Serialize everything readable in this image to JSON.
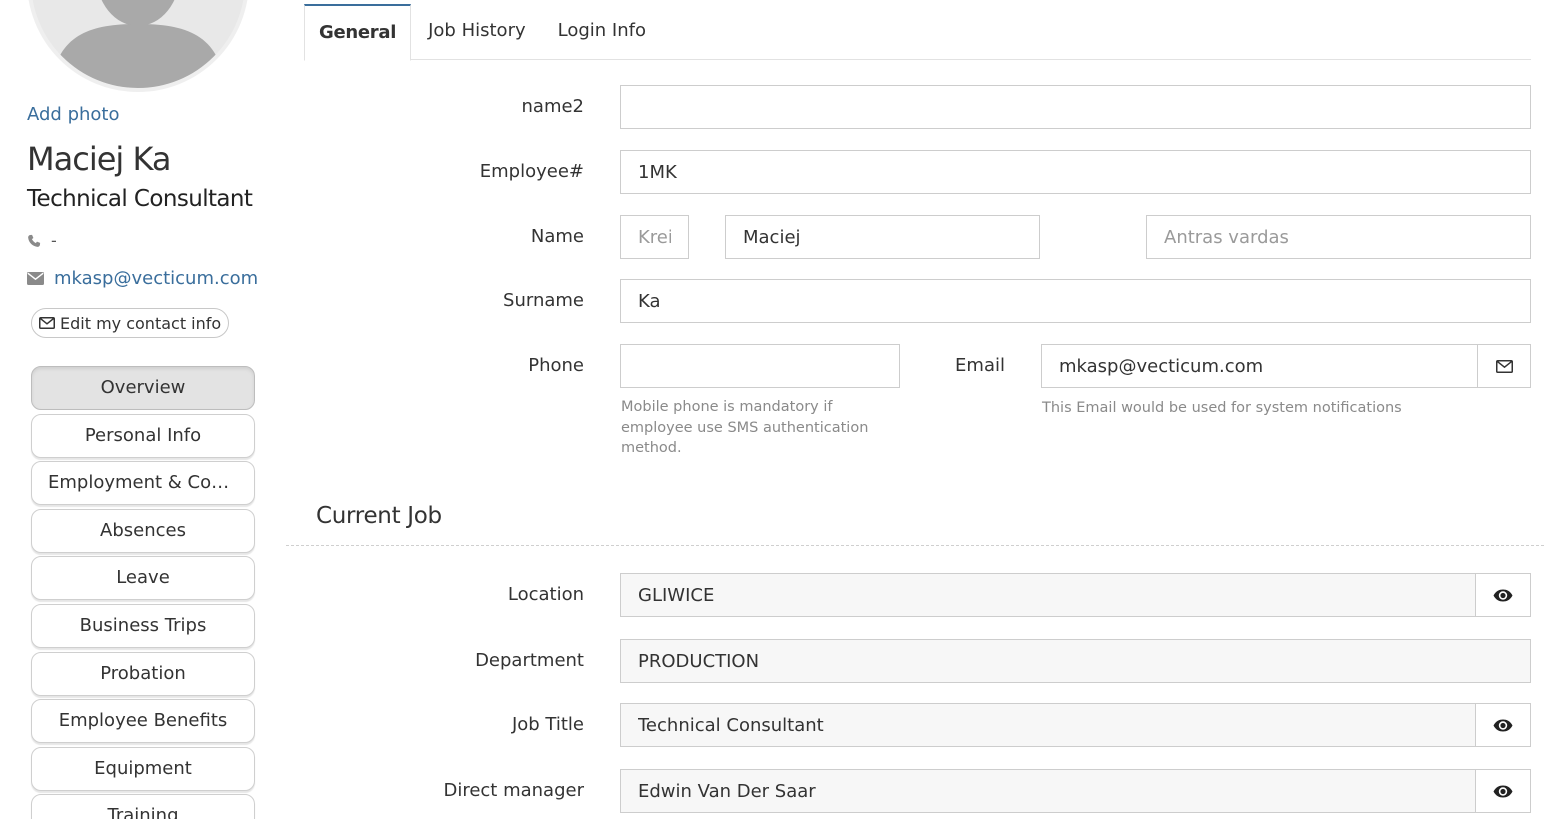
{
  "profile": {
    "add_photo": "Add photo",
    "name": "Maciej Ka",
    "title": "Technical Consultant",
    "phone": "-",
    "email": "mkasp@vecticum.com",
    "edit_contact_label": "Edit my contact info"
  },
  "nav": {
    "items": [
      {
        "label": "Overview",
        "active": true
      },
      {
        "label": "Personal Info"
      },
      {
        "label": "Employment & Com..."
      },
      {
        "label": "Absences"
      },
      {
        "label": "Leave"
      },
      {
        "label": "Business Trips"
      },
      {
        "label": "Probation"
      },
      {
        "label": "Employee Benefits"
      },
      {
        "label": "Equipment"
      },
      {
        "label": "Training"
      }
    ]
  },
  "tabs": [
    {
      "label": "General",
      "active": true
    },
    {
      "label": "Job History"
    },
    {
      "label": "Login Info"
    }
  ],
  "form": {
    "name2": {
      "label": "name2",
      "value": ""
    },
    "employee_no": {
      "label": "Employee#",
      "value": "1MK"
    },
    "name": {
      "label": "Name",
      "prefix_placeholder": "Krei",
      "first_value": "Maciej",
      "second_placeholder": "Antras vardas"
    },
    "surname": {
      "label": "Surname",
      "value": "Ka"
    },
    "phone": {
      "label": "Phone",
      "value": "",
      "help": "Mobile phone is mandatory if employee use SMS authentication method."
    },
    "email": {
      "label": "Email",
      "value": "mkasp@vecticum.com",
      "help": "This Email would be used for system notifications"
    }
  },
  "current_job": {
    "title": "Current Job",
    "location": {
      "label": "Location",
      "value": "GLIWICE"
    },
    "department": {
      "label": "Department",
      "value": "PRODUCTION"
    },
    "job_title": {
      "label": "Job Title",
      "value": "Technical Consultant"
    },
    "direct_manager": {
      "label": "Direct manager",
      "value": "Edwin Van Der Saar"
    }
  },
  "icons": {
    "phone": "phone-icon",
    "envelope": "envelope-icon",
    "eye": "eye-icon"
  },
  "colors": {
    "link": "#3a6e9c",
    "active_tab_border": "#3a6e9c",
    "readonly_bg": "#f7f7f7"
  }
}
